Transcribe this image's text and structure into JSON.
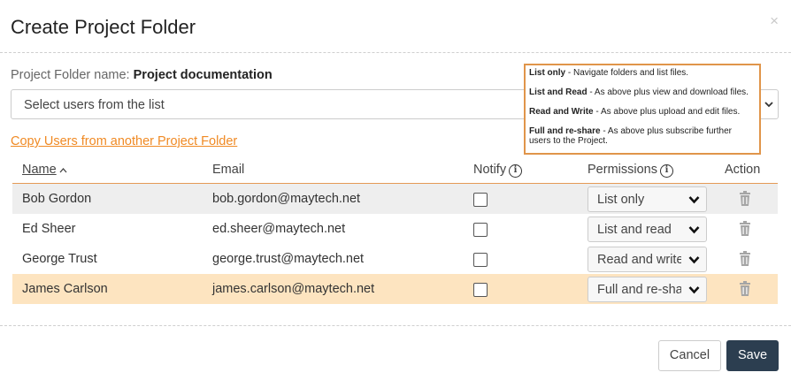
{
  "dialog": {
    "title": "Create Project Folder",
    "close_symbol": "×"
  },
  "folder": {
    "label": "Project Folder name:",
    "name": "Project documentation"
  },
  "user_select": {
    "placeholder": "Select users from the list"
  },
  "copy_link": "Copy Users from another Project Folder",
  "tooltip": {
    "items": [
      {
        "term": "List only",
        "desc": " - Navigate folders and list files."
      },
      {
        "term": "List and Read",
        "desc": " - As above plus view and download files."
      },
      {
        "term": "Read and Write",
        "desc": " - As above plus upload and edit files."
      },
      {
        "term": "Full and re-share",
        "desc": " - As above plus subscribe further users to the Project."
      }
    ]
  },
  "table": {
    "headers": {
      "name": "Name",
      "email": "Email",
      "notify": "Notify",
      "permissions": "Permissions",
      "action": "Action"
    },
    "rows": [
      {
        "name": "Bob Gordon",
        "email": "bob.gordon@maytech.net",
        "permission": "List only"
      },
      {
        "name": "Ed Sheer",
        "email": "ed.sheer@maytech.net",
        "permission": "List and read"
      },
      {
        "name": "George Trust",
        "email": "george.trust@maytech.net",
        "permission": "Read and write"
      },
      {
        "name": "James Carlson",
        "email": "james.carlson@maytech.net",
        "permission": "Full and re-share"
      }
    ]
  },
  "buttons": {
    "cancel": "Cancel",
    "save": "Save"
  },
  "colors": {
    "accent": "#f08a24",
    "save_bg": "#2c3e50",
    "selected_row": "#fde4c0",
    "alt_row": "#eeeeee"
  },
  "icons": [
    "close-icon",
    "chevron-down-icon",
    "sort-up-icon",
    "info-icon",
    "caret-down-icon",
    "trash-icon"
  ]
}
